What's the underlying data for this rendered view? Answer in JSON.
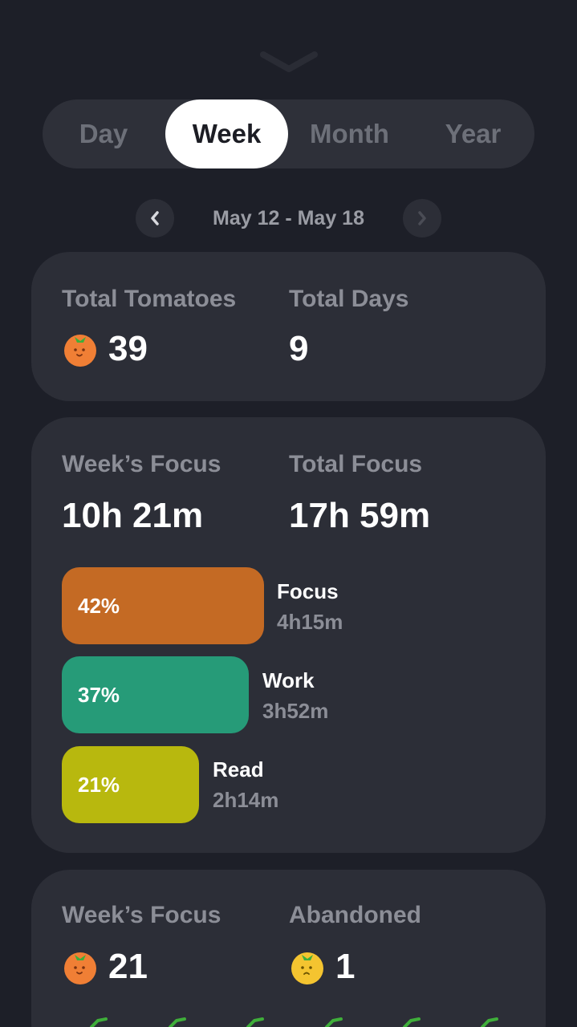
{
  "tabs": [
    {
      "label": "Day",
      "active": false
    },
    {
      "label": "Week",
      "active": true
    },
    {
      "label": "Month",
      "active": false
    },
    {
      "label": "Year",
      "active": false
    }
  ],
  "date_range": "May 12 - May 18",
  "summary": {
    "total_tomatoes_label": "Total Tomatoes",
    "total_tomatoes_value": "39",
    "total_days_label": "Total Days",
    "total_days_value": "9"
  },
  "focus": {
    "week_focus_label": "Week’s Focus",
    "week_focus_value": "10h 21m",
    "total_focus_label": "Total Focus",
    "total_focus_value": "17h 59m",
    "categories": [
      {
        "percent": "42%",
        "name": "Focus",
        "time": "4h15m",
        "color": "#c46a24",
        "share": 0.42
      },
      {
        "percent": "37%",
        "name": "Work",
        "time": "3h52m",
        "color": "#269b78",
        "share": 0.37
      },
      {
        "percent": "21%",
        "name": "Read",
        "time": "2h14m",
        "color": "#b8b80e",
        "share": 0.21
      }
    ]
  },
  "tomatoes": {
    "week_focus_label": "Week’s Focus",
    "week_focus_value": "21",
    "abandoned_label": "Abandoned",
    "abandoned_value": "1"
  },
  "colors": {
    "background": "#1d1f28",
    "card": "#2c2e37",
    "tomato_orange": "#f07f35",
    "tomato_yellow": "#f4c430",
    "leaf_green": "#3fae3a"
  },
  "icons": {
    "collapse": "chevron-down-icon",
    "prev": "chevron-left-icon",
    "next": "chevron-right-icon",
    "tomato": "tomato-icon",
    "abandoned": "yellow-tomato-icon",
    "check": "check-icon"
  }
}
